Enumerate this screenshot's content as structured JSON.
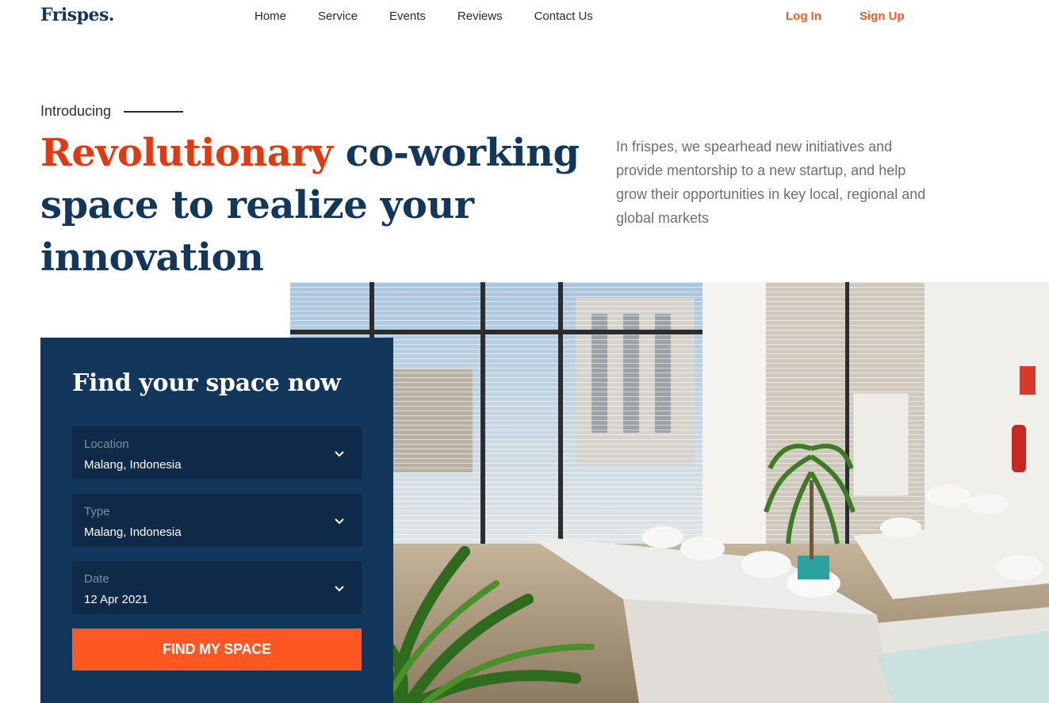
{
  "brand": {
    "logo": "Frispes."
  },
  "nav": {
    "links": [
      "Home",
      "Service",
      "Events",
      "Reviews",
      "Contact Us"
    ],
    "login": "Log In",
    "signup": "Sign Up"
  },
  "hero": {
    "intro": "Introducing",
    "headline_accent": "Revolutionary",
    "headline_rest": " co-working space to realize your innovation",
    "description": "In frispes, we spearhead new initiatives and provide mentorship to a new startup, and help grow their opportunities in key local, regional and global markets"
  },
  "search": {
    "title": "Find your space now",
    "fields": [
      {
        "label": "Location",
        "value": "Malang, Indonesia"
      },
      {
        "label": "Type",
        "value": "Malang, Indonesia"
      },
      {
        "label": "Date",
        "value": "12 Apr 2021"
      }
    ],
    "button": "FIND MY SPACE"
  },
  "colors": {
    "navy": "#13365b",
    "accent_red": "#e03a12",
    "button_orange": "#fe5722",
    "link_orange": "#f05a28"
  }
}
